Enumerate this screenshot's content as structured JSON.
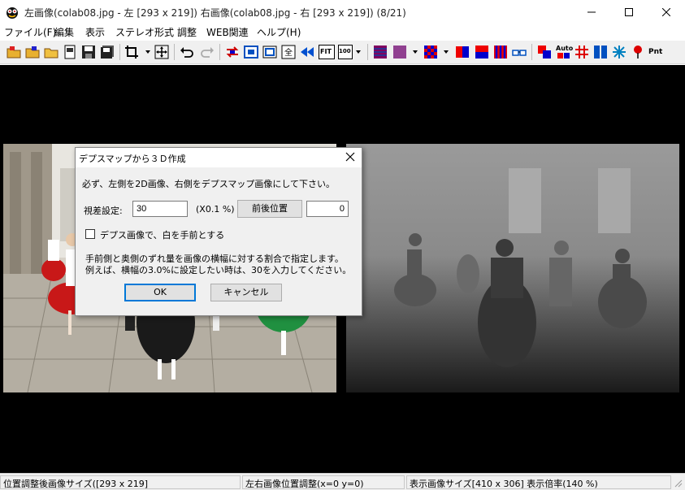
{
  "window": {
    "title": "左画像(colab08.jpg - 左 [293 x 219]) 右画像(colab08.jpg - 右 [293 x 219])  (8/21)"
  },
  "menu": [
    "ファイル(F)",
    "編集",
    "表示",
    "ステレオ形式",
    "調整",
    "WEB関連",
    "ヘルプ(H)"
  ],
  "toolbar": {
    "fit_label": "FIT",
    "zoom_label": "100",
    "auto_label": "Auto",
    "pnt_label": "Pnt"
  },
  "dialog": {
    "title": "デプスマップから３Ｄ作成",
    "instruction": "必ず、左側を2D画像、右側をデプスマップ画像にして下さい。",
    "parallax_label": "視差設定:",
    "parallax_value": "30",
    "parallax_unit": "(X0.1 %)",
    "front_back_button": "前後位置",
    "front_back_value": "0",
    "checkbox_label": "デプス画像で、白を手前とする",
    "checkbox_checked": false,
    "note_line1": "手前側と奥側のずれ量を画像の横幅に対する割合で指定します。",
    "note_line2": "例えば、横幅の3.0%に設定したい時は、30を入力してください。",
    "ok_label": "OK",
    "cancel_label": "キャンセル"
  },
  "status": {
    "pane1": "位置調整後画像サイズ([293 x 219]",
    "pane2": "左右画像位置調整(x=0 y=0)",
    "pane3": "表示画像サイズ[410 x 306]  表示倍率(140 %)"
  },
  "colors": {
    "workspace_bg": "#000000",
    "dialog_bg": "#f0f0f0",
    "accent_blue": "#0078d7"
  }
}
